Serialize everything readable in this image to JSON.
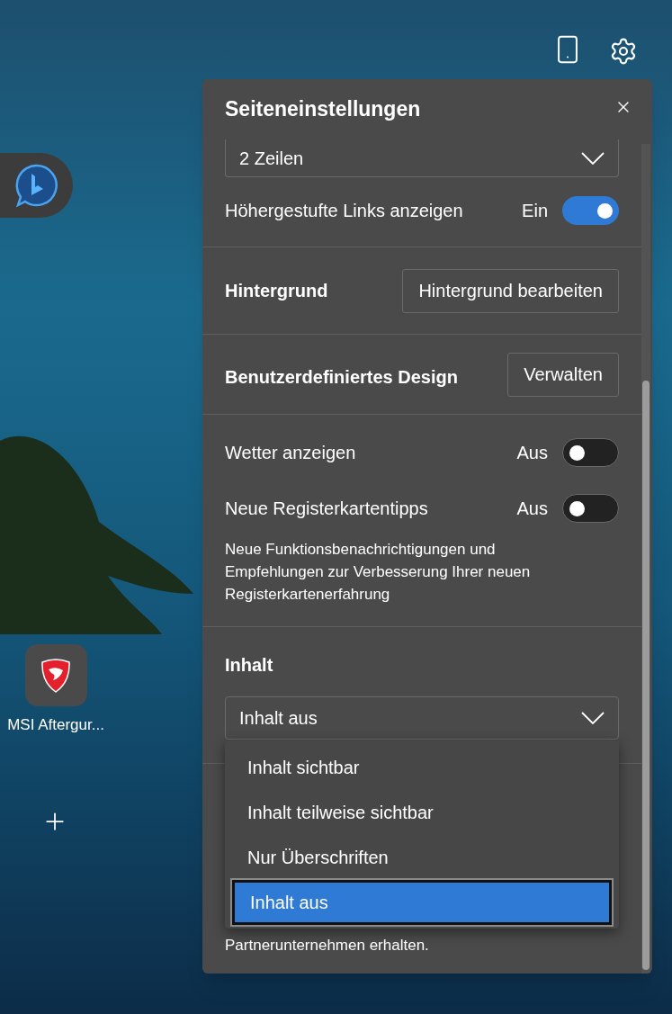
{
  "desktop": {
    "shortcuts": [
      {
        "kind": "app",
        "label": "MSI Aftergur..."
      },
      {
        "kind": "add"
      }
    ]
  },
  "panel": {
    "title": "Seiteneinstellungen",
    "layout_select": {
      "value": "2 Zeilen"
    },
    "promoted_links": {
      "label": "Höhergestufte Links anzeigen",
      "state_text": "Ein",
      "on": true
    },
    "background": {
      "label": "Hintergrund",
      "button": "Hintergrund bearbeiten"
    },
    "custom_design": {
      "label": "Benutzerdefiniertes Design",
      "button": "Verwalten"
    },
    "toggles": [
      {
        "label": "Wetter anzeigen",
        "state_text": "Aus",
        "on": false
      },
      {
        "label": "Neue Registerkartentipps",
        "state_text": "Aus",
        "on": false
      }
    ],
    "tips_description": "Neue Funktionsbenachrichtigungen und Empfehlungen zur Verbesserung Ihrer neuen Registerkartenerfahrung",
    "content": {
      "label": "Inhalt",
      "value": "Inhalt aus",
      "options": [
        {
          "label": "Inhalt sichtbar",
          "selected": false
        },
        {
          "label": "Inhalt teilweise sichtbar",
          "selected": false
        },
        {
          "label": "Nur Überschriften",
          "selected": false
        },
        {
          "label": "Inhalt aus",
          "selected": true
        }
      ]
    },
    "footer_text": "Partnerunternehmen erhalten."
  }
}
